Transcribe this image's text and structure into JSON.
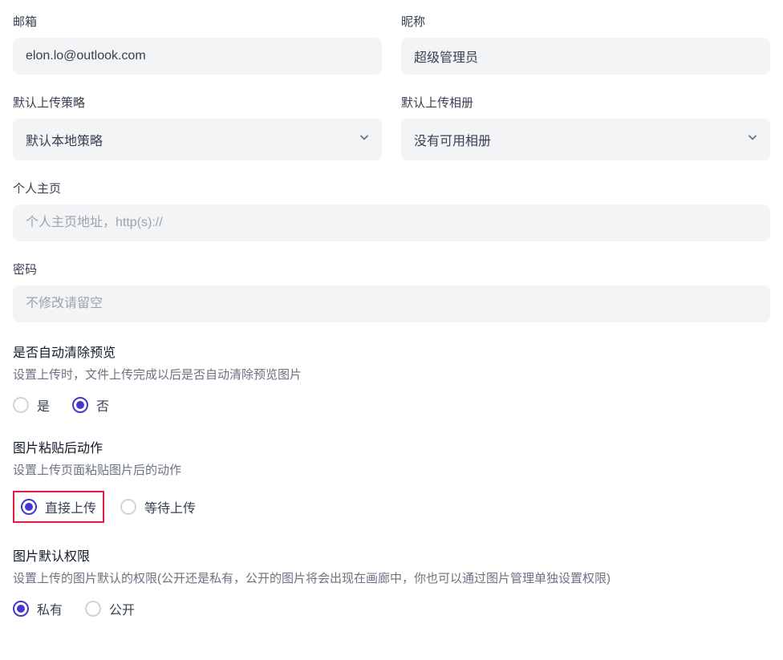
{
  "fields": {
    "email": {
      "label": "邮箱",
      "value": "elon.lo@outlook.com"
    },
    "nickname": {
      "label": "昵称",
      "value": "超级管理员"
    },
    "upload_strategy": {
      "label": "默认上传策略",
      "value": "默认本地策略"
    },
    "upload_album": {
      "label": "默认上传相册",
      "value": "没有可用相册"
    },
    "homepage": {
      "label": "个人主页",
      "placeholder": "个人主页地址，http(s)://"
    },
    "password": {
      "label": "密码",
      "placeholder": "不修改请留空"
    }
  },
  "sections": {
    "auto_clear": {
      "title": "是否自动清除预览",
      "desc": "设置上传时，文件上传完成以后是否自动清除预览图片",
      "options": {
        "yes": "是",
        "no": "否"
      },
      "selected": "no"
    },
    "paste_action": {
      "title": "图片粘贴后动作",
      "desc": "设置上传页面粘贴图片后的动作",
      "options": {
        "direct": "直接上传",
        "wait": "等待上传"
      },
      "selected": "direct"
    },
    "default_permission": {
      "title": "图片默认权限",
      "desc": "设置上传的图片默认的权限(公开还是私有，公开的图片将会出现在画廊中，你也可以通过图片管理单独设置权限)",
      "options": {
        "private": "私有",
        "public": "公开"
      },
      "selected": "private"
    }
  }
}
